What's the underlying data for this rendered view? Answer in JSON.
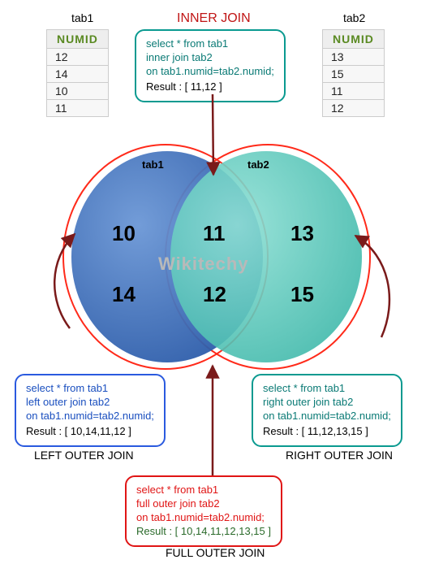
{
  "labels": {
    "tab1": "tab1",
    "tab2": "tab2",
    "inner": "INNER JOIN",
    "left": "LEFT OUTER JOIN",
    "right": "RIGHT OUTER JOIN",
    "full": "FULL OUTER JOIN"
  },
  "tables": {
    "tab1": {
      "header": "NUMID",
      "rows": [
        "12",
        "14",
        "10",
        "11"
      ]
    },
    "tab2": {
      "header": "NUMID",
      "rows": [
        "13",
        "15",
        "11",
        "12"
      ]
    }
  },
  "venn": {
    "left_label": "tab1",
    "right_label": "tab2",
    "left_only": [
      "10",
      "14"
    ],
    "intersection": [
      "11",
      "12"
    ],
    "right_only": [
      "13",
      "15"
    ],
    "watermark": "Wikitechy",
    "colors": {
      "left": "#3e70b9",
      "right": "#5ac9bd",
      "outline": "#ff2a1a"
    }
  },
  "queries": {
    "inner": {
      "color": "#0a7a75",
      "l1": "select * from tab1",
      "l2": "inner join tab2",
      "l3": "on tab1.numid=tab2.numid;",
      "result": "Result : [ 11,12 ]"
    },
    "left": {
      "color": "#1a4fbf",
      "l1": "select * from tab1",
      "l2": "left outer join tab2",
      "l3": "on tab1.numid=tab2.numid;",
      "result": "Result : [ 10,14,11,12 ]"
    },
    "right": {
      "color": "#0a7a75",
      "l1": "select * from tab1",
      "l2": "right outer join tab2",
      "l3": "on tab1.numid=tab2.numid;",
      "result": "Result : [ 11,12,13,15 ]"
    },
    "full": {
      "color": "#e01515",
      "l1": "select * from tab1",
      "l2": "full outer join tab2",
      "l3": "on tab1.numid=tab2.numid;",
      "result_color": "#2a6a2a",
      "result": "Result : [ 10,14,11,12,13,15 ]"
    }
  },
  "chart_data": {
    "type": "venn",
    "sets": [
      {
        "name": "tab1",
        "values": [
          12,
          14,
          10,
          11
        ]
      },
      {
        "name": "tab2",
        "values": [
          13,
          15,
          11,
          12
        ]
      }
    ],
    "regions": {
      "tab1_only": [
        10,
        14
      ],
      "intersection": [
        11,
        12
      ],
      "tab2_only": [
        13,
        15
      ]
    },
    "joins": {
      "inner": [
        11,
        12
      ],
      "left_outer": [
        10,
        14,
        11,
        12
      ],
      "right_outer": [
        11,
        12,
        13,
        15
      ],
      "full_outer": [
        10,
        14,
        11,
        12,
        13,
        15
      ]
    }
  }
}
